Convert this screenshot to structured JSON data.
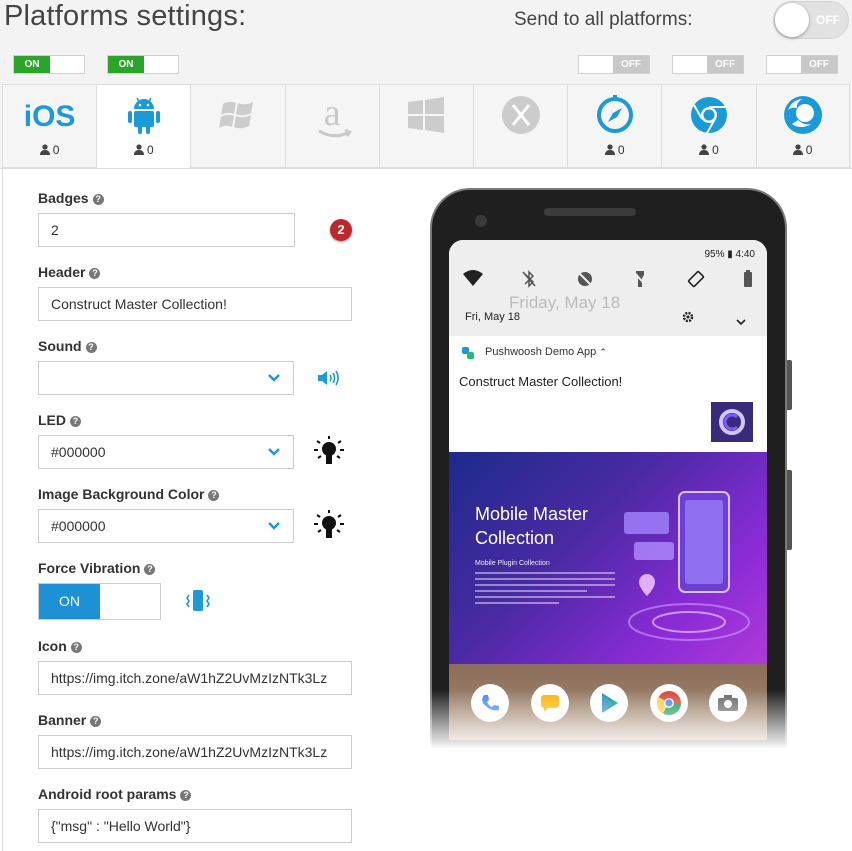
{
  "header": {
    "title": "Platforms settings:",
    "send_all_label": "Send to all platforms:",
    "send_all_state": "OFF"
  },
  "platform_toggles": [
    {
      "platform": "ios",
      "state": "ON"
    },
    {
      "platform": "android",
      "state": "ON"
    },
    {
      "platform": "safari",
      "state": "OFF"
    },
    {
      "platform": "chrome",
      "state": "OFF"
    },
    {
      "platform": "firefox",
      "state": "OFF"
    }
  ],
  "tabs": [
    {
      "name": "iOS",
      "icon": "ios-text-icon",
      "count": "0",
      "active": false
    },
    {
      "name": "Android",
      "icon": "android-icon",
      "count": "0",
      "active": true
    },
    {
      "name": "Windows Phone",
      "icon": "windows-phone-icon",
      "count": "",
      "active": false
    },
    {
      "name": "Amazon",
      "icon": "amazon-icon",
      "count": "",
      "active": false
    },
    {
      "name": "Windows",
      "icon": "windows-icon",
      "count": "",
      "active": false
    },
    {
      "name": "Mac OS X",
      "icon": "mac-x-icon",
      "count": "",
      "active": false
    },
    {
      "name": "Safari",
      "icon": "safari-icon",
      "count": "0",
      "active": false
    },
    {
      "name": "Chrome",
      "icon": "chrome-icon",
      "count": "0",
      "active": false
    },
    {
      "name": "Firefox",
      "icon": "firefox-icon",
      "count": "0",
      "active": false
    }
  ],
  "form": {
    "badges_label": "Badges",
    "badges_value": "2",
    "badge_preview": "2",
    "header_label": "Header",
    "header_value": "Construct Master Collection!",
    "sound_label": "Sound",
    "sound_value": "",
    "led_label": "LED",
    "led_value": "#000000",
    "image_bg_label": "Image Background Color",
    "image_bg_value": "#000000",
    "vibration_label": "Force Vibration",
    "vibration_state": "ON",
    "icon_label": "Icon",
    "icon_value": "https://img.itch.zone/aW1hZ2UvMzIzNTk3Lz",
    "banner_label": "Banner",
    "banner_value": "https://img.itch.zone/aW1hZ2UvMzIzNTk3Lz",
    "root_params_label": "Android root params",
    "root_params_value": "{\"msg\" : \"Hello World\"}"
  },
  "preview": {
    "status": "95% ▮ 4:40",
    "date": "Fri, May 18",
    "ghost_date": "Friday, May 18",
    "app_name": "Pushwoosh Demo App",
    "notif_title": "Construct Master Collection!",
    "banner_title_1": "Mobile Master",
    "banner_title_2": "Collection",
    "banner_sub": "Mobile Plugin Collection"
  },
  "colors": {
    "on_green": "#2aa52a",
    "vibration_blue": "#1e90d6",
    "accent_blue": "#1a9ad6",
    "badge_red": "#c0272d"
  }
}
